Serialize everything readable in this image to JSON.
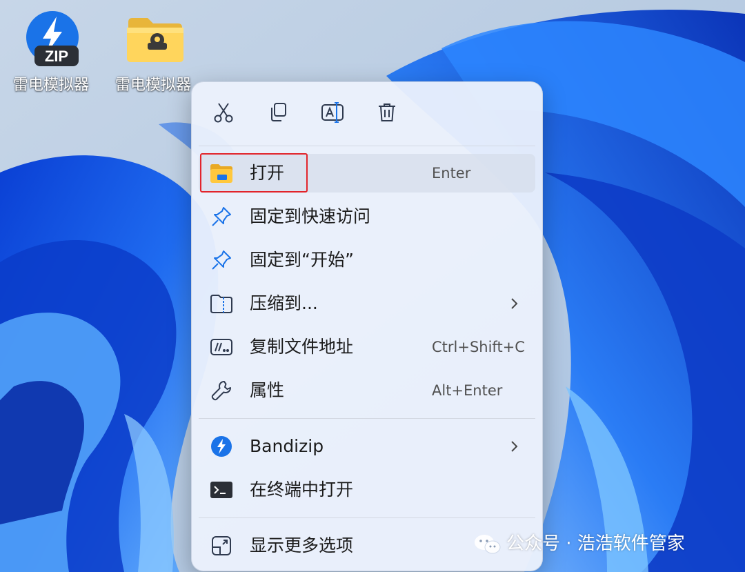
{
  "desktop": {
    "icons": [
      {
        "label": "雷电模拟器",
        "icon": "zip-archive-icon"
      },
      {
        "label": "雷电模拟器",
        "icon": "folder-icon"
      }
    ]
  },
  "toolbar": [
    {
      "action": "cut",
      "icon": "scissors-icon"
    },
    {
      "action": "copy",
      "icon": "copy-icon"
    },
    {
      "action": "rename",
      "icon": "rename-icon"
    },
    {
      "action": "delete",
      "icon": "trash-icon"
    }
  ],
  "menu": {
    "items": [
      {
        "label": "打开",
        "accelerator": "Enter",
        "icon": "folder-open-icon",
        "highlighted": true
      },
      {
        "label": "固定到快速访问",
        "accelerator": "",
        "icon": "pin-icon"
      },
      {
        "label": "固定到“开始”",
        "accelerator": "",
        "icon": "pin-icon"
      },
      {
        "label": "压缩到...",
        "accelerator": "",
        "icon": "zip-folder-icon",
        "submenu": true
      },
      {
        "label": "复制文件地址",
        "accelerator": "Ctrl+Shift+C",
        "icon": "copy-path-icon"
      },
      {
        "label": "属性",
        "accelerator": "Alt+Enter",
        "icon": "wrench-icon"
      },
      {
        "label": "Bandizip",
        "accelerator": "",
        "icon": "bandizip-icon",
        "submenu": true
      },
      {
        "label": "在终端中打开",
        "accelerator": "",
        "icon": "terminal-icon"
      },
      {
        "label": "显示更多选项",
        "accelerator": "",
        "icon": "more-options-icon"
      }
    ]
  },
  "watermark": {
    "text": "公众号 · 浩浩软件管家",
    "icon": "wechat-icon"
  },
  "colors": {
    "accent": "#1a73e8",
    "highlight_box": "#e2242b",
    "menu_background": "#ecf1fc",
    "wallpaper_blue": "#1f6bf0"
  }
}
